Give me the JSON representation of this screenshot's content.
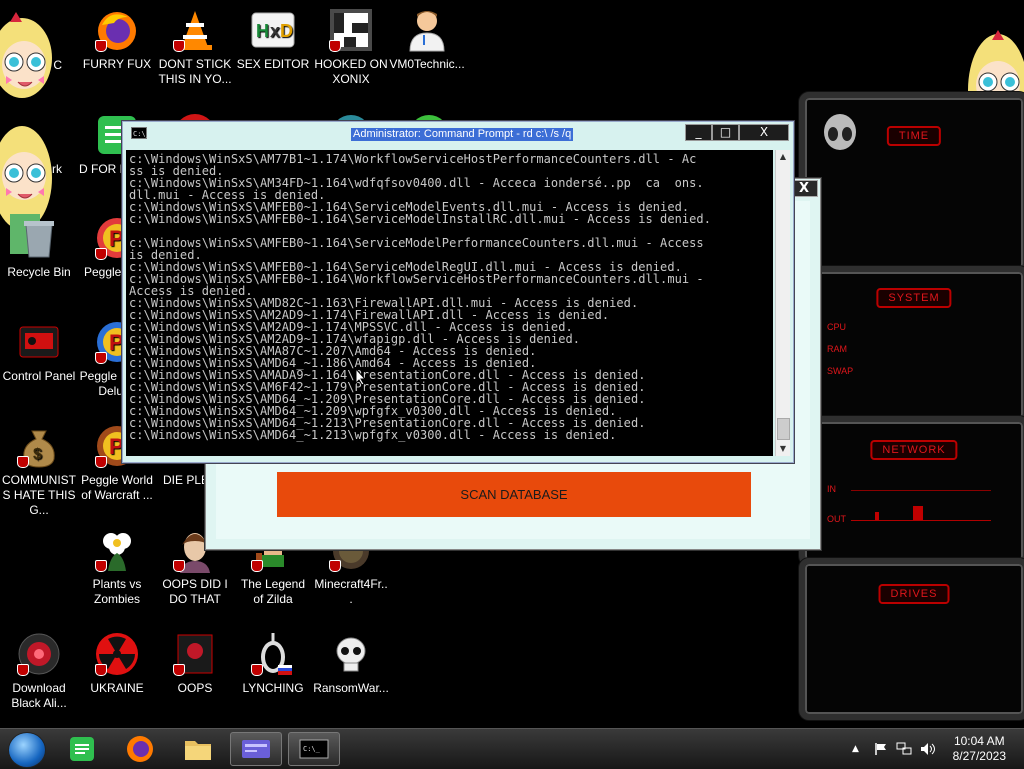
{
  "desktop": {
    "icons": [
      {
        "label": "FURRY FUX",
        "icon": "firefox-icon"
      },
      {
        "label": "DONT STICK THIS IN YO...",
        "icon": "vlc-cone-icon"
      },
      {
        "label": "SEX EDITOR",
        "icon": "hxd-icon"
      },
      {
        "label": "HOOKED ON XONIX",
        "icon": "xonix-icon"
      },
      {
        "label": "VM0Technic...",
        "icon": "doctor-icon"
      },
      {
        "label": "D FOR DUMB",
        "icon": "notes-icon"
      },
      {
        "label": "Recycle Bin",
        "icon": "recycle-bin-icon"
      },
      {
        "label": "Peggle De...",
        "icon": "peggle-icon"
      },
      {
        "label": "Control Panel",
        "icon": "control-panel-icon"
      },
      {
        "label": "Peggle Nights Deluxe",
        "icon": "peggle-icon"
      },
      {
        "label": "COMMUNISTS HATE THIS G...",
        "icon": "money-bag-icon"
      },
      {
        "label": "Peggle World of Warcraft ...",
        "icon": "peggle-icon"
      },
      {
        "label": "DIE PLEA...",
        "icon": "app-icon"
      },
      {
        "label": "Plants vs Zombies",
        "icon": "plant-icon"
      },
      {
        "label": "OOPS DID I DO THAT",
        "icon": "portrait-icon"
      },
      {
        "label": "The Legend of Zilda",
        "icon": "zelda-icon"
      },
      {
        "label": "Minecraft4Fr...",
        "icon": "minecraft-icon"
      },
      {
        "label": "Download Black Ali...",
        "icon": "alien-icon"
      },
      {
        "label": "UKRAINE",
        "icon": "radiation-icon"
      },
      {
        "label": "OOPS",
        "icon": "oops-icon"
      },
      {
        "label": "LYNCHING",
        "icon": "noose-icon"
      },
      {
        "label": "RansomWar...",
        "icon": "skull-icon"
      },
      {
        "label": "rk",
        "icon": "partial-icon"
      },
      {
        "label": "C",
        "icon": "partial-icon"
      }
    ]
  },
  "cmd": {
    "title": "Administrator: Command Prompt - rd  c:\\ /s /q",
    "minimize": "_",
    "maximize": "□",
    "close": "X",
    "lines": [
      "c:\\Windows\\WinSxS\\AM77B1~1.174\\WorkflowServiceHostPerformanceCounters.dll - Ac",
      "ss is denied.",
      "c:\\Windows\\WinSxS\\AM34FD~1.164\\wdfqfsov0400.dll - Acceca iondersé..pp  ca  ons.",
      "dll.mui - Access is denied.",
      "c:\\Windows\\WinSxS\\AMFEB0~1.164\\ServiceModelEvents.dll.mui - Access is denied.",
      "c:\\Windows\\WinSxS\\AMFEB0~1.164\\ServiceModelInstallRC.dll.mui - Access is denied.",
      "",
      "c:\\Windows\\WinSxS\\AMFEB0~1.164\\ServiceModelPerformanceCounters.dll.mui - Access",
      "is denied.",
      "c:\\Windows\\WinSxS\\AMFEB0~1.164\\ServiceModelRegUI.dll.mui - Access is denied.",
      "c:\\Windows\\WinSxS\\AMFEB0~1.164\\WorkflowServiceHostPerformanceCounters.dll.mui -",
      "Access is denied.",
      "c:\\Windows\\WinSxS\\AMD82C~1.163\\FirewallAPI.dll.mui - Access is denied.",
      "c:\\Windows\\WinSxS\\AM2AD9~1.174\\FirewallAPI.dll - Access is denied.",
      "c:\\Windows\\WinSxS\\AM2AD9~1.174\\MPSSVC.dll - Access is denied.",
      "c:\\Windows\\WinSxS\\AM2AD9~1.174\\wfapigp.dll - Access is denied.",
      "c:\\Windows\\WinSxS\\AMA87C~1.207\\Amd64 - Access is denied.",
      "c:\\Windows\\WinSxS\\AMD64_~1.186\\Amd64 - Access is denied.",
      "c:\\Windows\\WinSxS\\AMADA9~1.164\\PresentationCore.dll - Access is denied.",
      "c:\\Windows\\WinSxS\\AM6F42~1.179\\PresentationCore.dll - Access is denied.",
      "c:\\Windows\\WinSxS\\AMD64_~1.209\\PresentationCore.dll - Access is denied.",
      "c:\\Windows\\WinSxS\\AMD64_~1.209\\wpfgfx_v0300.dll - Access is denied.",
      "c:\\Windows\\WinSxS\\AMD64_~1.213\\PresentationCore.dll - Access is denied.",
      "c:\\Windows\\WinSxS\\AMD64_~1.213\\wpfgfx_v0300.dll - Access is denied."
    ]
  },
  "scanner": {
    "button": "SCAN DATABASE",
    "close": "X"
  },
  "gadget": {
    "time_title": "TIME",
    "system_title": "SYSTEM",
    "cpu": "CPU",
    "ram": "RAM",
    "swap": "SWAP",
    "network_title": "NETWORK",
    "net_in": "IN",
    "net_out": "OUT",
    "drives_title": "DRIVES"
  },
  "taskbar": {
    "time": "10:04 AM",
    "date": "8/27/2023"
  }
}
